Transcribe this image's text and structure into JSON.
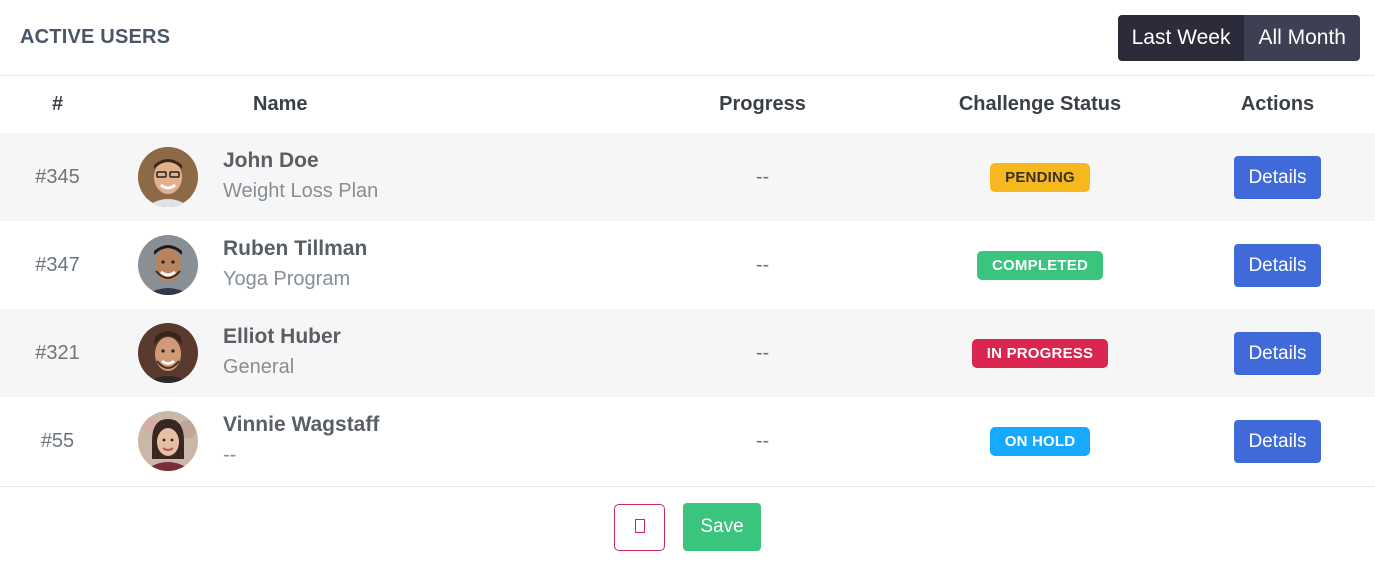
{
  "header": {
    "title": "ACTIVE USERS",
    "range_buttons": [
      "Last Week",
      "All Month"
    ]
  },
  "table": {
    "columns": [
      "#",
      "Name",
      "Progress",
      "Challenge Status",
      "Actions"
    ],
    "rows": [
      {
        "id": "#345",
        "name": "John Doe",
        "plan": "Weight Loss Plan",
        "progress": "--",
        "status": "PENDING",
        "status_color": "#f6b81f",
        "action": "Details"
      },
      {
        "id": "#347",
        "name": "Ruben Tillman",
        "plan": "Yoga Program",
        "progress": "--",
        "status": "COMPLETED",
        "status_color": "#3ac47d",
        "action": "Details"
      },
      {
        "id": "#321",
        "name": "Elliot Huber",
        "plan": "General",
        "progress": "--",
        "status": "IN PROGRESS",
        "status_color": "#d92550",
        "action": "Details"
      },
      {
        "id": "#55",
        "name": "Vinnie Wagstaff",
        "plan": "--",
        "progress": "--",
        "status": "ON HOLD",
        "status_color": "#16aaff",
        "action": "Details"
      }
    ]
  },
  "footer": {
    "delete_icon": "trash-icon",
    "save_label": "Save"
  },
  "colors": {
    "primary": "#3f6ad8",
    "success": "#3ac47d",
    "danger": "#d92550",
    "warning": "#f6b81f",
    "info": "#16aaff",
    "dark": "#2b2b3a"
  }
}
